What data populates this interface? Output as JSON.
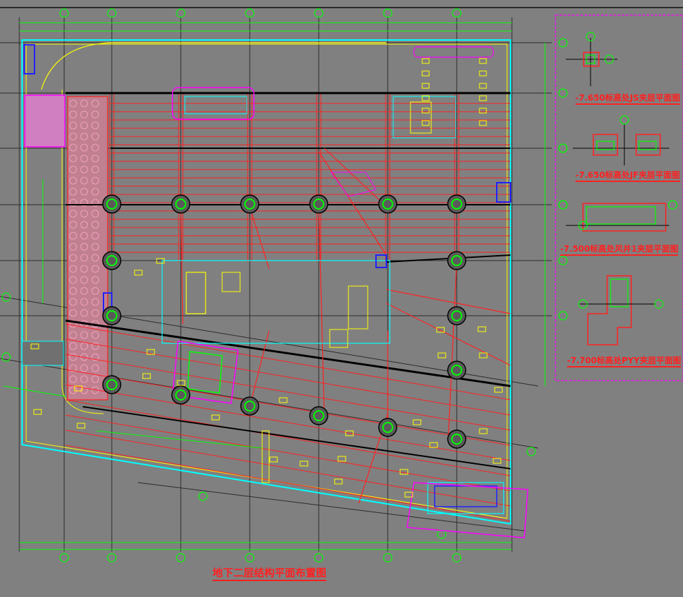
{
  "drawing": {
    "main_title": "地下二层结构平面布置图",
    "details": [
      {
        "title": "-7.650标高处JS夹层平面图"
      },
      {
        "title": "-7.650标高处JF夹层平面图"
      },
      {
        "title": "-7.500标高处风井1夹层平面图"
      },
      {
        "title": "-7.700标高处PYY夹层平面图"
      }
    ]
  },
  "colors": {
    "background": "#808080",
    "grid": "#2a2a2a",
    "axis_bubble": "#00ff00",
    "beam": "#ff2020",
    "wall": "#00ffff",
    "edge": "#ffff00",
    "zone": "#ff00ff",
    "column": "#00ff00",
    "dark": "#000000",
    "blue": "#2020ff"
  }
}
